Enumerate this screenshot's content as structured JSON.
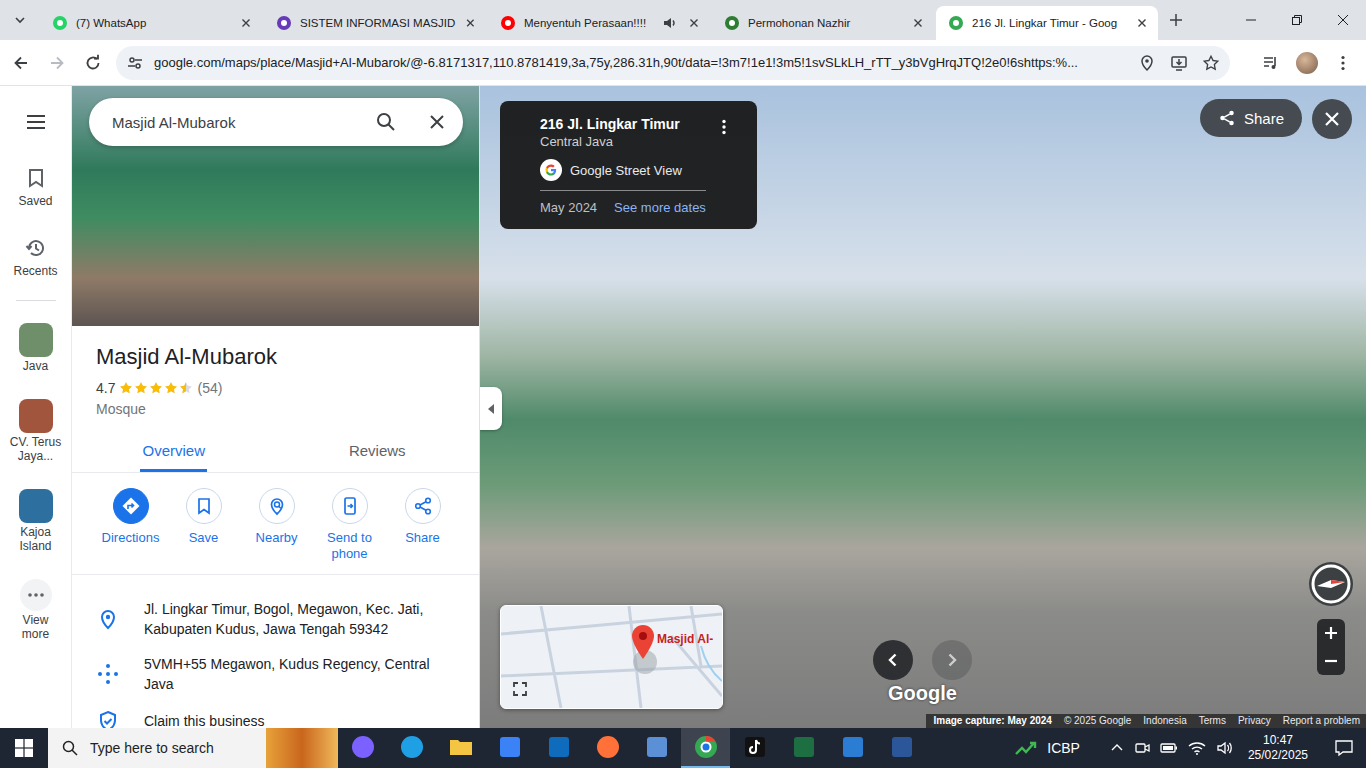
{
  "browser": {
    "tabs": [
      {
        "label": "(7) WhatsApp",
        "selected": false,
        "audio": false,
        "color": "#25d366"
      },
      {
        "label": "SISTEM INFORMASI MASJID",
        "selected": false,
        "audio": false,
        "color": "#673ab7"
      },
      {
        "label": "Menyentuh Perasaan!!!!",
        "selected": false,
        "audio": true,
        "color": "#ff0000"
      },
      {
        "label": "Permohonan Nazhir",
        "selected": false,
        "audio": false,
        "color": "#2e7d32"
      },
      {
        "label": "216 Jl. Lingkar Timur - Goog",
        "selected": true,
        "audio": false,
        "color": "#34a853"
      }
    ],
    "url": "google.com/maps/place/Masjid+Al-Mubarok/@-6.8171317,110.8781419,3a,75y,286.31h,90t/data=!3m7!1e1!3m5!1svSLkLH_rTT_y3bVgHrqJTQ!2e0!6shttps:%...",
    "forward_disabled": true
  },
  "rail": {
    "items": [
      {
        "label": "Saved",
        "kind": "saved",
        "color": "#5f6368"
      },
      {
        "label": "Recents",
        "kind": "recents",
        "color": "#5f6368"
      },
      {
        "label": "Java",
        "kind": "thumb",
        "color": "#6f8f6a"
      },
      {
        "label": "CV. Terus Jaya...",
        "kind": "thumb",
        "color": "#a2553d"
      },
      {
        "label": "Kajoa Island",
        "kind": "thumb",
        "color": "#2d6f9e"
      },
      {
        "label": "View more",
        "kind": "more",
        "color": "#5f6368"
      }
    ]
  },
  "search": {
    "value": "Masjid Al-Mubarok"
  },
  "place": {
    "name": "Masjid Al-Mubarok",
    "rating": "4.7",
    "stars": 4.5,
    "reviews": "(54)",
    "category": "Mosque"
  },
  "panel_tabs": [
    {
      "label": "Overview",
      "selected": true
    },
    {
      "label": "Reviews",
      "selected": false
    }
  ],
  "actions": [
    {
      "label": "Directions",
      "kind": "directions",
      "primary": true
    },
    {
      "label": "Save",
      "kind": "save",
      "primary": false
    },
    {
      "label": "Nearby",
      "kind": "nearby",
      "primary": false
    },
    {
      "label": "Send to phone",
      "kind": "phone",
      "primary": false
    },
    {
      "label": "Share",
      "kind": "share",
      "primary": false
    }
  ],
  "info": [
    {
      "kind": "address",
      "text": "Jl. Lingkar Timur, Bogol, Megawon, Kec. Jati, Kabupaten Kudus, Jawa Tengah 59342"
    },
    {
      "kind": "pluscode",
      "text": "5VMH+55 Megawon, Kudus Regency, Central Java"
    },
    {
      "kind": "claim",
      "text": "Claim this business"
    }
  ],
  "street_view": {
    "title": "216 Jl. Lingkar Timur",
    "region": "Central Java",
    "source": "Google Street View",
    "date": "May 2024",
    "more_dates": "See more dates",
    "share": "Share",
    "map_label": "Masjid Al-",
    "logo": "Google",
    "nav": [
      {
        "disabled": false
      },
      {
        "disabled": true
      }
    ],
    "footer": [
      "Image capture: May 2024",
      "© 2025 Google",
      "Indonesia",
      "Terms",
      "Privacy",
      "Report a problem"
    ]
  },
  "taskbar": {
    "search_placeholder": "Type here to search",
    "apps": [
      {
        "kind": "copilot",
        "color": "#7b61ff",
        "selected": false
      },
      {
        "kind": "edge",
        "color": "#1fa0e4",
        "selected": false
      },
      {
        "kind": "explorer",
        "color": "#f4c542",
        "selected": false
      },
      {
        "kind": "store",
        "color": "#3b82f6",
        "selected": false
      },
      {
        "kind": "outlook",
        "color": "#0f6cbd",
        "selected": false
      },
      {
        "kind": "firefox",
        "color": "#ff7139",
        "selected": false
      },
      {
        "kind": "photos",
        "color": "#5b8fd6",
        "selected": false
      },
      {
        "kind": "chrome",
        "color": "#34a853",
        "selected": true
      },
      {
        "kind": "tiktok",
        "color": "#111111",
        "selected": false
      },
      {
        "kind": "excel",
        "color": "#1d6f42",
        "selected": false
      },
      {
        "kind": "maps",
        "color": "#2b7cd3",
        "selected": false
      },
      {
        "kind": "word",
        "color": "#2b579a",
        "selected": false
      }
    ],
    "tray_label": "ICBP",
    "time": "10:47",
    "date": "25/02/2025"
  }
}
